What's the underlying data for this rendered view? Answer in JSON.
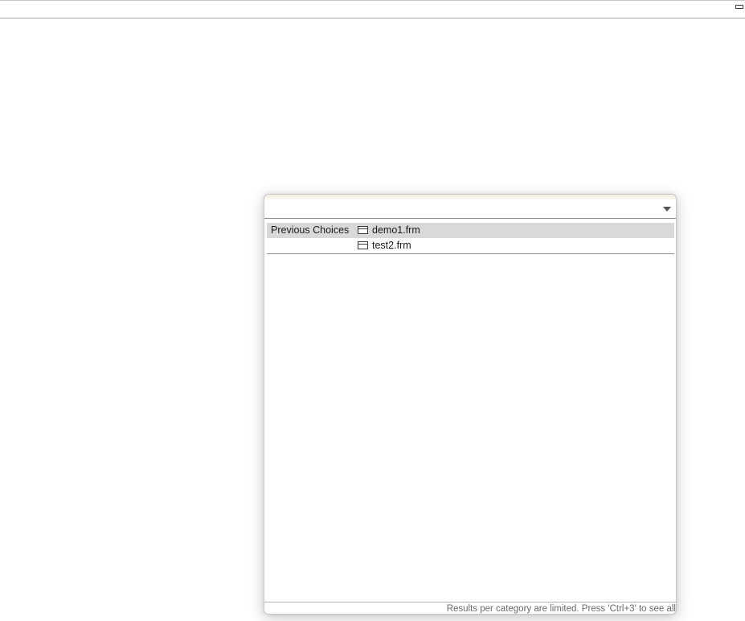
{
  "filter": {
    "value": "",
    "placeholder": ""
  },
  "results": {
    "categories": [
      {
        "name": "Previous Choices",
        "items": [
          {
            "label": "demo1.frm",
            "icon": "form-icon",
            "selected": true
          },
          {
            "label": "test2.frm",
            "icon": "form-icon",
            "selected": false
          }
        ]
      }
    ]
  },
  "status": {
    "text": "Results per category are limited. Press 'Ctrl+3' to see all"
  },
  "colors": {
    "selection": "#d9d9d9",
    "header_tint": "#f3efe4",
    "status_text": "#6a6a6a"
  }
}
